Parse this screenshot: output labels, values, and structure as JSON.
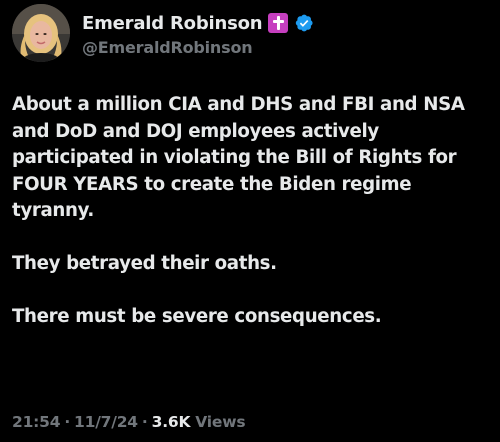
{
  "author": {
    "display_name": "Emerald Robinson",
    "handle": "@EmeraldRobinson",
    "badges": [
      "cross-icon",
      "verified-icon"
    ],
    "verified_color": "#1d9bf0",
    "cross_badge_color": "#c63fbf"
  },
  "tweet": {
    "paragraphs": [
      "About a million CIA and DHS and FBI and NSA and DoD and DOJ employees actively participated in violating the Bill of Rights for FOUR YEARS to create the Biden regime tyranny.",
      "They betrayed their oaths.",
      "There must be severe consequences."
    ]
  },
  "meta": {
    "time": "21:54",
    "separator": "·",
    "date": "11/7/24",
    "views_count": "3.6K",
    "views_label": "Views"
  },
  "theme": {
    "background": "#000000",
    "text_primary": "#e7e9ea",
    "text_muted": "#71767b"
  }
}
